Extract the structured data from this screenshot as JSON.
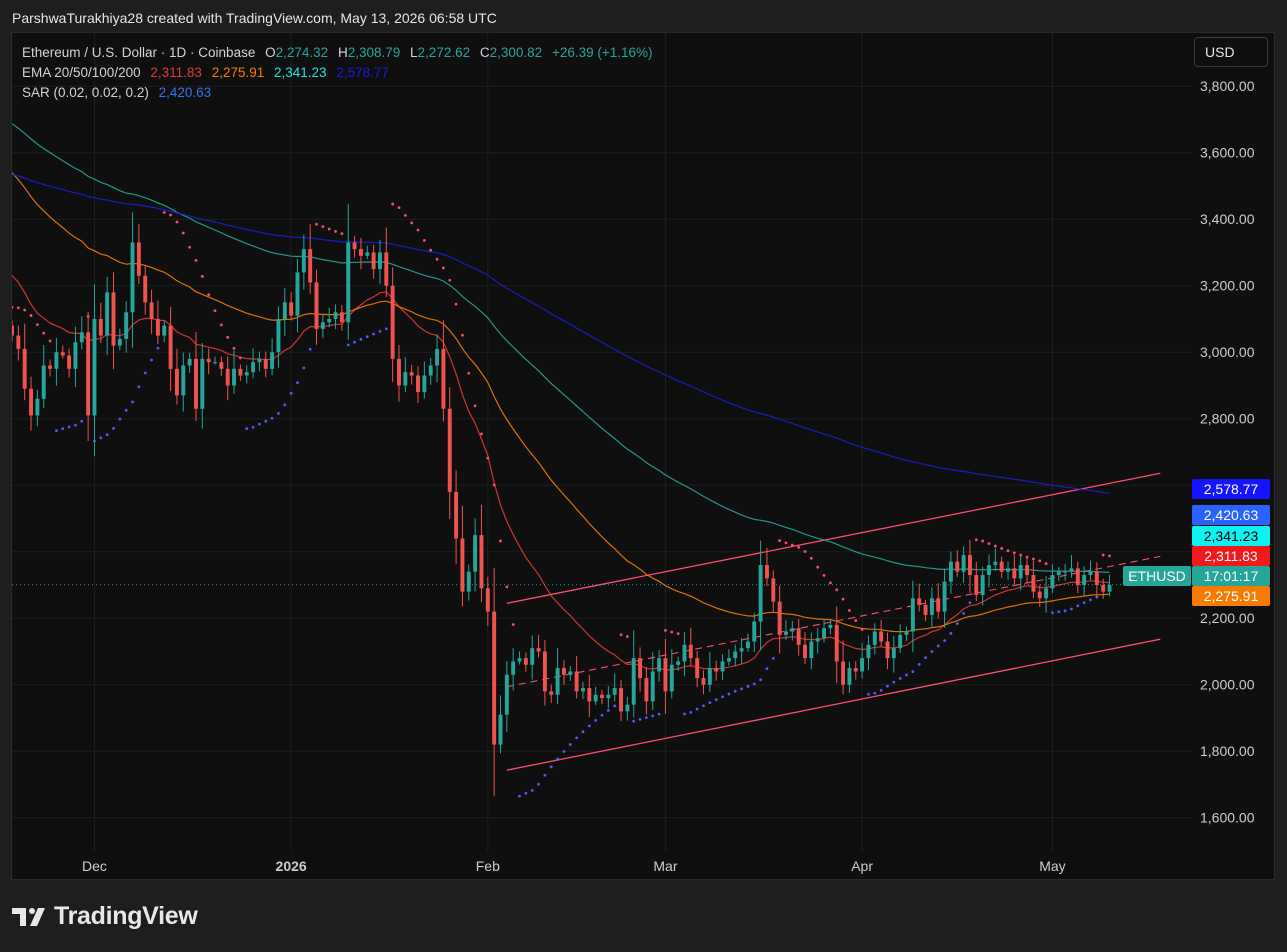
{
  "credit": "ParshwaTurakhiya28 created with TradingView.com, May 13, 2026 06:58 UTC",
  "brand": "TradingView",
  "currency_button": "USD",
  "legend": {
    "symbol": "Ethereum / U.S. Dollar · 1D · Coinbase",
    "o_label": "O",
    "o_value": "2,274.32",
    "h_label": "H",
    "h_value": "2,308.79",
    "l_label": "L",
    "l_value": "2,272.62",
    "c_label": "C",
    "c_value": "2,300.82",
    "change": "+26.39 (+1.16%)",
    "ema_label": "EMA 20/50/100/200",
    "ema20": "2,311.83",
    "ema50": "2,275.91",
    "ema100": "2,341.23",
    "ema200": "2,578.77",
    "sar_label": "SAR (0.02, 0.02, 0.2)",
    "sar": "2,420.63"
  },
  "colors": {
    "up": "#26a69a",
    "down": "#ef5350",
    "ema20": "#e53935",
    "ema50": "#f57c00",
    "ema100": "#26a69a",
    "ema200": "#1a1fd6",
    "sar": "#4f5bff",
    "sar_down": "#ff4d6d",
    "channel": "#ff4d6d"
  },
  "chart_data": {
    "type": "candlestick",
    "symbol": "ETHUSD",
    "ylim": [
      1500,
      3960
    ],
    "y_ticks": [
      1600,
      1800,
      2000,
      2200,
      2400,
      2600,
      2800,
      3000,
      3200,
      3400,
      3600,
      3800
    ],
    "y_tick_labels": [
      "1,600.00",
      "1,800.00",
      "2,000.00",
      "2,200.00",
      "2,400.00",
      "2,600.00",
      "2,800.00",
      "3,000.00",
      "3,200.00",
      "3,400.00",
      "3,600.00",
      "3,800.00"
    ],
    "x_range_dates": [
      "2025-11-18",
      "2026-05-23"
    ],
    "x_ticks": [
      {
        "date": "2025-12-01",
        "label": "Dec",
        "bold": false
      },
      {
        "date": "2026-01-01",
        "label": "2026",
        "bold": true
      },
      {
        "date": "2026-02-01",
        "label": "Feb",
        "bold": false
      },
      {
        "date": "2026-03-01",
        "label": "Mar",
        "bold": false
      },
      {
        "date": "2026-04-01",
        "label": "Apr",
        "bold": false
      },
      {
        "date": "2026-05-01",
        "label": "May",
        "bold": false
      }
    ],
    "first_candle_date": "2025-11-18",
    "closes": [
      3050,
      3010,
      2890,
      2810,
      2860,
      2960,
      2950,
      3000,
      2990,
      2950,
      3030,
      3060,
      2810,
      3100,
      3050,
      3180,
      3020,
      3040,
      3120,
      3330,
      3230,
      3150,
      3100,
      3050,
      3080,
      2950,
      2870,
      2960,
      2980,
      2830,
      2980,
      2970,
      2970,
      2950,
      2900,
      2950,
      2930,
      2940,
      2970,
      2980,
      2950,
      3000,
      3100,
      3150,
      3110,
      3240,
      3310,
      3210,
      3070,
      3090,
      3100,
      3120,
      3090,
      3330,
      3310,
      3290,
      3300,
      3250,
      3300,
      3200,
      2980,
      2900,
      2940,
      2930,
      2880,
      2930,
      2960,
      3010,
      2830,
      2580,
      2440,
      2280,
      2340,
      2450,
      2290,
      2220,
      1820,
      1910,
      2030,
      2070,
      2080,
      2060,
      2110,
      2100,
      1980,
      1970,
      2050,
      2030,
      2040,
      1980,
      1990,
      1950,
      1970,
      1960,
      1970,
      1990,
      1920,
      1940,
      2080,
      2020,
      1950,
      2040,
      2080,
      1980,
      2060,
      2070,
      2120,
      2080,
      2020,
      2000,
      2050,
      2040,
      2070,
      2080,
      2100,
      2110,
      2130,
      2190,
      2360,
      2320,
      2250,
      2150,
      2160,
      2170,
      2120,
      2080,
      2130,
      2140,
      2170,
      2180,
      2070,
      2000,
      2050,
      2040,
      2080,
      2120,
      2160,
      2130,
      2080,
      2110,
      2150,
      2160,
      2260,
      2240,
      2210,
      2260,
      2220,
      2310,
      2370,
      2340,
      2390,
      2330,
      2270,
      2330,
      2360,
      2370,
      2340,
      2350,
      2320,
      2360,
      2330,
      2280,
      2260,
      2290,
      2330,
      2340,
      2340,
      2350,
      2300,
      2330,
      2340,
      2300,
      2280,
      2300
    ],
    "ema_values": [
      {
        "name": "EMA 20",
        "value": 2311.83,
        "label": "2,311.83",
        "color": "#e53935"
      },
      {
        "name": "EMA 50",
        "value": 2275.91,
        "label": "2,275.91",
        "color": "#f57c00"
      },
      {
        "name": "EMA 100",
        "value": 2341.23,
        "label": "2,341.23",
        "color": "#26a69a"
      },
      {
        "name": "EMA 200",
        "value": 2578.77,
        "label": "2,578.77",
        "color": "#1a1fd6"
      }
    ],
    "sar_value": {
      "value": 2420.63,
      "label": "2,420.63",
      "color": "#3a6df0"
    },
    "last_price": {
      "value": 2300.82,
      "symbol": "ETHUSD",
      "countdown": "17:01:17"
    },
    "channel": {
      "upper": [
        {
          "date": "2026-02-04",
          "price": 2245
        },
        {
          "date": "2026-05-18",
          "price": 2636
        }
      ],
      "lower": [
        {
          "date": "2026-02-04",
          "price": 1743
        },
        {
          "date": "2026-05-18",
          "price": 2137
        }
      ],
      "mid": [
        {
          "date": "2026-02-04",
          "price": 1994
        },
        {
          "date": "2026-05-18",
          "price": 2386
        }
      ]
    }
  }
}
